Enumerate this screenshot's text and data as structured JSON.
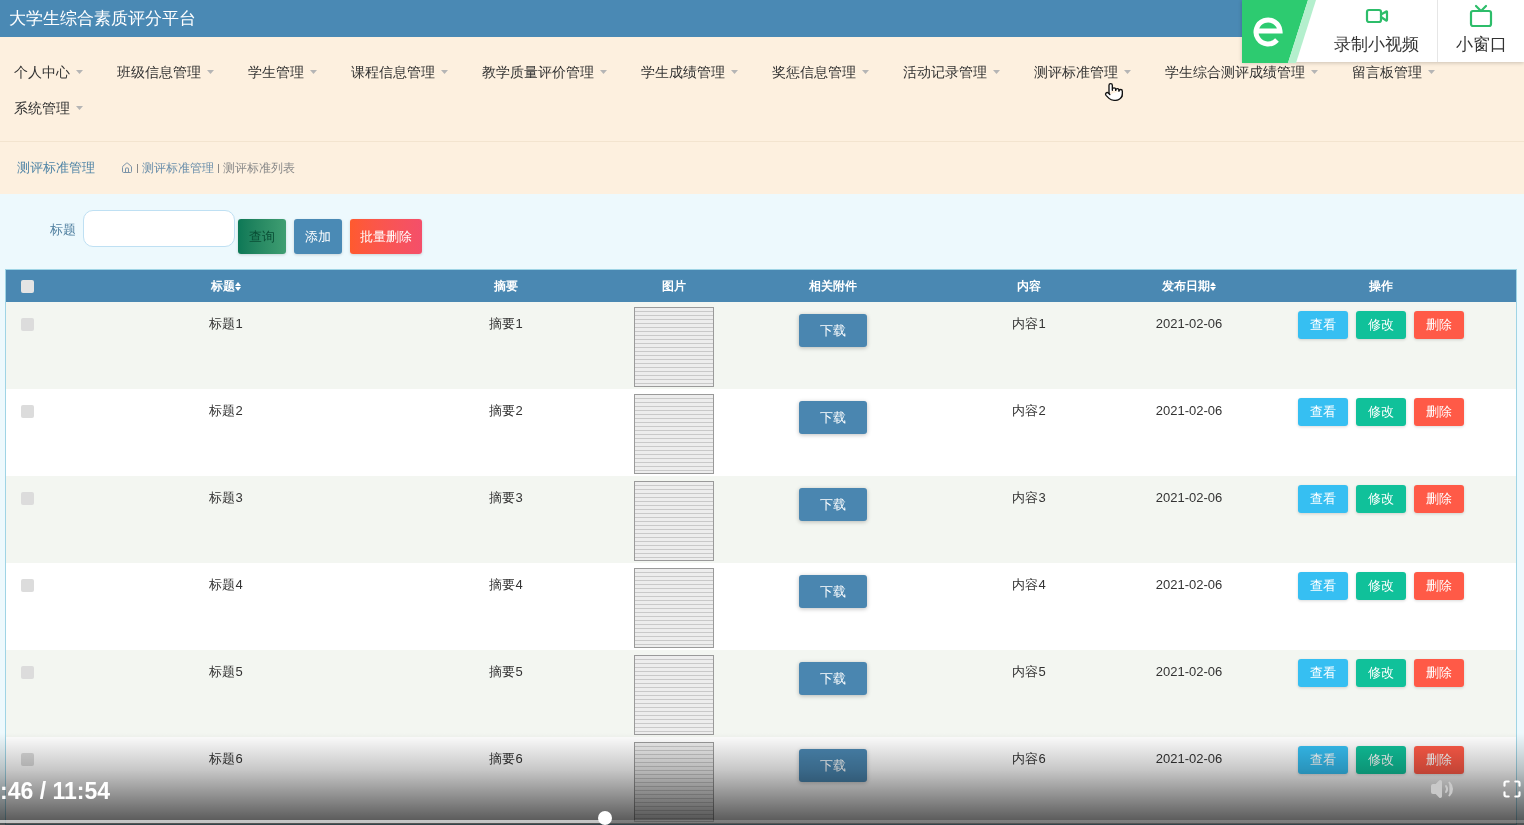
{
  "header": {
    "title": "大学生综合素质评分平台"
  },
  "recorder": {
    "buttons": [
      {
        "kind": "video",
        "label": "录制小视频"
      },
      {
        "kind": "window",
        "label": "小窗口"
      }
    ]
  },
  "nav": {
    "items": [
      {
        "label": "个人中心"
      },
      {
        "label": "班级信息管理"
      },
      {
        "label": "学生管理"
      },
      {
        "label": "课程信息管理"
      },
      {
        "label": "教学质量评价管理"
      },
      {
        "label": "学生成绩管理"
      },
      {
        "label": "奖惩信息管理"
      },
      {
        "label": "活动记录管理"
      },
      {
        "label": "测评标准管理"
      },
      {
        "label": "学生综合测评成绩管理"
      },
      {
        "label": "留言板管理"
      },
      {
        "label": "系统管理"
      }
    ]
  },
  "page_header": {
    "title": "测评标准管理",
    "breadcrumb": [
      "测评标准管理",
      "测评标准列表"
    ]
  },
  "search": {
    "label": "标题",
    "buttons": [
      {
        "kind": "search",
        "label": "查询"
      },
      {
        "kind": "add",
        "label": "添加"
      },
      {
        "kind": "batch_delete",
        "label": "批量删除"
      }
    ]
  },
  "table": {
    "select_all_checked": false,
    "columns": [
      {
        "label": "标题",
        "sortable": true
      },
      {
        "label": "摘要",
        "sortable": false
      },
      {
        "label": "图片",
        "sortable": false
      },
      {
        "label": "相关附件",
        "sortable": false
      },
      {
        "label": "内容",
        "sortable": false
      },
      {
        "label": "发布日期",
        "sortable": true
      },
      {
        "label": "操作",
        "sortable": false
      }
    ],
    "rows": [
      {
        "checked": false,
        "title": "标题1",
        "summary": "摘要1",
        "attachment": "下载",
        "content": "内容1",
        "date": "2021-02-06",
        "actions": [
          {
            "kind": "view",
            "label": "查看"
          },
          {
            "kind": "edit",
            "label": "修改"
          },
          {
            "kind": "delete",
            "label": "删除"
          }
        ]
      },
      {
        "checked": false,
        "title": "标题2",
        "summary": "摘要2",
        "attachment": "下载",
        "content": "内容2",
        "date": "2021-02-06",
        "actions": [
          {
            "kind": "view",
            "label": "查看"
          },
          {
            "kind": "edit",
            "label": "修改"
          },
          {
            "kind": "delete",
            "label": "删除"
          }
        ]
      },
      {
        "checked": false,
        "title": "标题3",
        "summary": "摘要3",
        "attachment": "下载",
        "content": "内容3",
        "date": "2021-02-06",
        "actions": [
          {
            "kind": "view",
            "label": "查看"
          },
          {
            "kind": "edit",
            "label": "修改"
          },
          {
            "kind": "delete",
            "label": "删除"
          }
        ]
      },
      {
        "checked": false,
        "title": "标题4",
        "summary": "摘要4",
        "attachment": "下载",
        "content": "内容4",
        "date": "2021-02-06",
        "actions": [
          {
            "kind": "view",
            "label": "查看"
          },
          {
            "kind": "edit",
            "label": "修改"
          },
          {
            "kind": "delete",
            "label": "删除"
          }
        ]
      },
      {
        "checked": false,
        "title": "标题5",
        "summary": "摘要5",
        "attachment": "下载",
        "content": "内容5",
        "date": "2021-02-06",
        "actions": [
          {
            "kind": "view",
            "label": "查看"
          },
          {
            "kind": "edit",
            "label": "修改"
          },
          {
            "kind": "delete",
            "label": "删除"
          }
        ]
      },
      {
        "checked": false,
        "title": "标题6",
        "summary": "摘要6",
        "attachment": "下载",
        "content": "内容6",
        "date": "2021-02-06",
        "actions": [
          {
            "kind": "view",
            "label": "查看"
          },
          {
            "kind": "edit",
            "label": "修改"
          },
          {
            "kind": "delete",
            "label": "删除"
          }
        ]
      }
    ]
  },
  "video_player": {
    "time": ":46 / 11:54",
    "level": 0.397
  }
}
